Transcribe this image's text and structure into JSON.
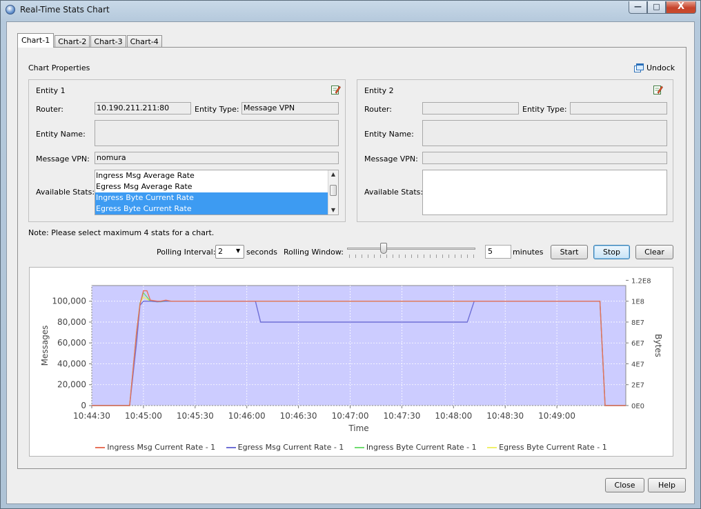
{
  "window": {
    "title": "Real-Time Stats Chart",
    "controls": {
      "minimize": "—",
      "maximize": "□",
      "close": "X"
    }
  },
  "tabs": [
    {
      "label": "Chart-1",
      "active": true
    },
    {
      "label": "Chart-2",
      "active": false
    },
    {
      "label": "Chart-3",
      "active": false
    },
    {
      "label": "Chart-4",
      "active": false
    }
  ],
  "properties": {
    "heading": "Chart Properties",
    "undock_label": "Undock"
  },
  "entity1": {
    "title": "Entity 1",
    "router_label": "Router:",
    "router_value": "10.190.211.211:80",
    "entity_type_label": "Entity Type:",
    "entity_type_value": "Message VPN",
    "entity_name_label": "Entity Name:",
    "entity_name_value": "",
    "vpn_label": "Message VPN:",
    "vpn_value": "nomura",
    "stats_label": "Available Stats:",
    "stats": [
      {
        "label": "Ingress Msg Average Rate",
        "selected": false
      },
      {
        "label": "Egress Msg Average Rate",
        "selected": false
      },
      {
        "label": "Ingress Byte Current Rate",
        "selected": true
      },
      {
        "label": "Egress Byte Current Rate",
        "selected": true
      }
    ]
  },
  "entity2": {
    "title": "Entity 2",
    "router_label": "Router:",
    "router_value": "",
    "entity_type_label": "Entity Type:",
    "entity_type_value": "",
    "entity_name_label": "Entity Name:",
    "entity_name_value": "",
    "vpn_label": "Message VPN:",
    "vpn_value": "",
    "stats_label": "Available Stats:"
  },
  "note": "Note: Please select maximum 4 stats for a chart.",
  "controls": {
    "polling_label": "Polling Interval:",
    "polling_value": "2",
    "seconds_label": "seconds",
    "rolling_label": "Rolling Window:",
    "rolling_slider_fraction": 0.27,
    "rolling_value": "5",
    "minutes_label": "minutes",
    "start_label": "Start",
    "stop_label": "Stop",
    "clear_label": "Clear"
  },
  "footer": {
    "close_label": "Close",
    "help_label": "Help"
  },
  "chart_data": {
    "type": "line",
    "title": "",
    "xlabel": "Time",
    "ylabel": "Messages",
    "y2label": "Bytes",
    "xticks": [
      "10:44:30",
      "10:45:00",
      "10:45:30",
      "10:46:00",
      "10:46:30",
      "10:47:00",
      "10:47:30",
      "10:48:00",
      "10:48:30",
      "10:49:00"
    ],
    "xlim_seconds_from_10_44_30": [
      0,
      310
    ],
    "yticks": [
      "0",
      "20,000",
      "40,000",
      "60,000",
      "80,000",
      "100,000"
    ],
    "ylim": [
      0,
      115000
    ],
    "y2ticks": [
      "0E0",
      "2E7",
      "4E7",
      "6E7",
      "8E7",
      "1E8",
      "1.2E8"
    ],
    "y2lim": [
      0,
      120000000.0
    ],
    "grid": true,
    "legend_position": "bottom",
    "background": "#ccccff",
    "series": [
      {
        "name": "Ingress Msg Current Rate - 1",
        "color": "#e8725a",
        "x": [
          0,
          22,
          26,
          28,
          30,
          32,
          34,
          38,
          40,
          43,
          46,
          50,
          295,
          298,
          310
        ],
        "y": [
          0,
          0,
          70000,
          97000,
          110000,
          110000,
          101000,
          100000,
          100000,
          101000,
          100000,
          100000,
          100000,
          0,
          0
        ]
      },
      {
        "name": "Egress Msg Current Rate - 1",
        "color": "#6f6fd6",
        "x": [
          0,
          22,
          26,
          28,
          30,
          34,
          38,
          42,
          45,
          50,
          95,
          98,
          218,
          222,
          295,
          298,
          310
        ],
        "y": [
          0,
          0,
          60000,
          96000,
          100000,
          100000,
          99500,
          100000,
          100000,
          100000,
          100000,
          80000,
          80000,
          100000,
          100000,
          0,
          0
        ]
      },
      {
        "name": "Ingress Byte Current Rate - 1",
        "color": "#6fdc6f",
        "x": [
          0,
          22,
          26,
          28,
          30,
          34,
          38,
          40,
          43,
          46,
          50,
          295,
          298,
          310
        ],
        "y": [
          0,
          0,
          70000,
          98000,
          108000,
          100000,
          99500,
          99500,
          100000,
          100000,
          100000,
          100000,
          0,
          0
        ]
      },
      {
        "name": "Egress Byte Current Rate - 1",
        "color": "#f0f06a",
        "x": [
          0,
          22,
          26,
          28,
          30,
          34,
          40,
          50,
          295,
          298,
          310
        ],
        "y": [
          0,
          0,
          70000,
          98000,
          104000,
          100000,
          100000,
          100000,
          100000,
          0,
          0
        ]
      }
    ]
  }
}
